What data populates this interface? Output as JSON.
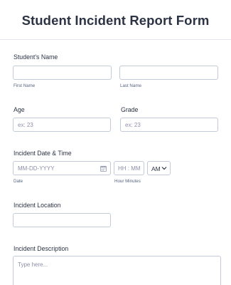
{
  "form": {
    "title": "Student Incident Report Form"
  },
  "student_name": {
    "label": "Student's Name",
    "first_sub": "First Name",
    "last_sub": "Last Name"
  },
  "age": {
    "label": "Age",
    "placeholder": "ex: 23"
  },
  "grade": {
    "label": "Grade",
    "placeholder": "ex: 23"
  },
  "incident_datetime": {
    "label": "Incident Date & Time",
    "date_placeholder": "MM-DD-YYYY",
    "time_placeholder": "HH : MM",
    "ampm_value": "AM",
    "date_sub": "Date",
    "time_sub": "Hour Minutes"
  },
  "incident_location": {
    "label": "Incident Location"
  },
  "incident_description": {
    "label": "Incident Description",
    "placeholder": "Type here..."
  },
  "icons": {
    "date_picker": "calendar-icon",
    "ampm_dropdown": "chevron-down-icon"
  }
}
